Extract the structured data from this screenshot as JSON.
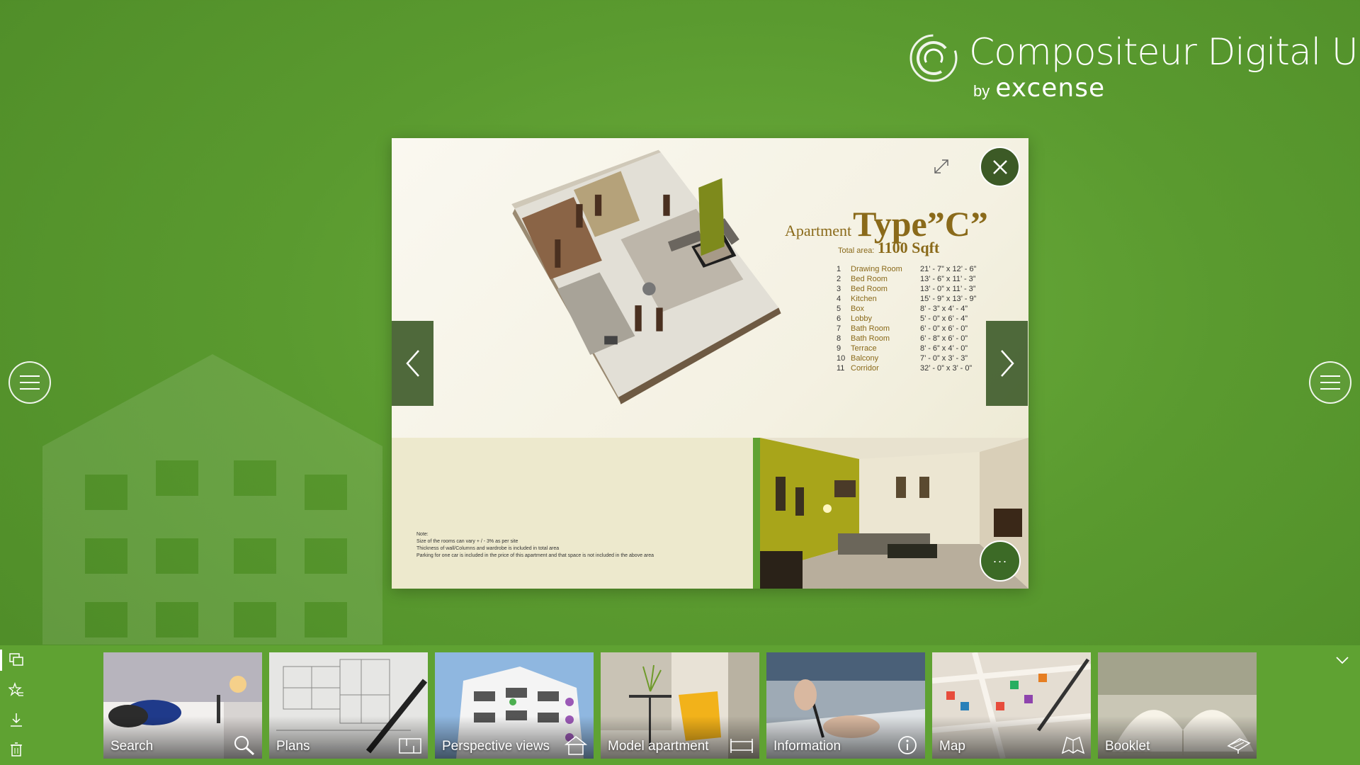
{
  "colors": {
    "background": "#5fa232",
    "accent_dark": "#3c5a26",
    "gold": "#8a6a1a"
  },
  "logo": {
    "title": "Compositeur Digital UX",
    "by": "by",
    "brand": "excense"
  },
  "viewer": {
    "apartment_prefix": "Apartment",
    "apartment_type": "Type”C”",
    "total_area_label": "Total area:",
    "total_area_value": "1100 Sqft",
    "rooms": [
      {
        "num": "1",
        "name": "Drawing Room",
        "dim": "21’ - 7” x 12’ - 6”"
      },
      {
        "num": "2",
        "name": "Bed Room",
        "dim": "13’ - 6” x 11’ - 3”"
      },
      {
        "num": "3",
        "name": "Bed Room",
        "dim": "13’ - 0” x 11’ - 3”"
      },
      {
        "num": "4",
        "name": "Kitchen",
        "dim": "15’ - 9” x 13’ - 9”"
      },
      {
        "num": "5",
        "name": "Box",
        "dim": "8’ - 3” x 4’ - 4”"
      },
      {
        "num": "6",
        "name": "Lobby",
        "dim": "5’ - 0” x 6’ - 4”"
      },
      {
        "num": "7",
        "name": "Bath Room",
        "dim": "6’ - 0” x 6’ - 0”"
      },
      {
        "num": "8",
        "name": "Bath Room",
        "dim": "6’ - 8” x 6’ - 0”"
      },
      {
        "num": "9",
        "name": "Terrace",
        "dim": "8’ - 6” x 4’ - 0”"
      },
      {
        "num": "10",
        "name": "Balcony",
        "dim": "7’ - 0” x 3’ - 3”"
      },
      {
        "num": "11",
        "name": "Corridor",
        "dim": "32’ - 0” x 3’ - 0”"
      }
    ],
    "note": {
      "heading": "Note:",
      "line1": "Size of the rooms can vary + / - 3% as per site",
      "line2": "Thickness of wall/Columns and wardrobe is included in total area",
      "line3": "Parking for one car is included in the price of this apartment and that space is not included in the above area"
    },
    "more_label": "···"
  },
  "tiles": [
    {
      "label": "Search",
      "icon": "search-icon"
    },
    {
      "label": "Plans",
      "icon": "plan-icon"
    },
    {
      "label": "Perspective views",
      "icon": "house-icon"
    },
    {
      "label": "Model apartment",
      "icon": "bed-icon"
    },
    {
      "label": "Information",
      "icon": "info-icon"
    },
    {
      "label": "Map",
      "icon": "map-icon"
    },
    {
      "label": "Booklet",
      "icon": "booklet-icon"
    }
  ],
  "tools": [
    "duplicate-icon",
    "favorite-icon",
    "download-icon",
    "trash-icon"
  ]
}
